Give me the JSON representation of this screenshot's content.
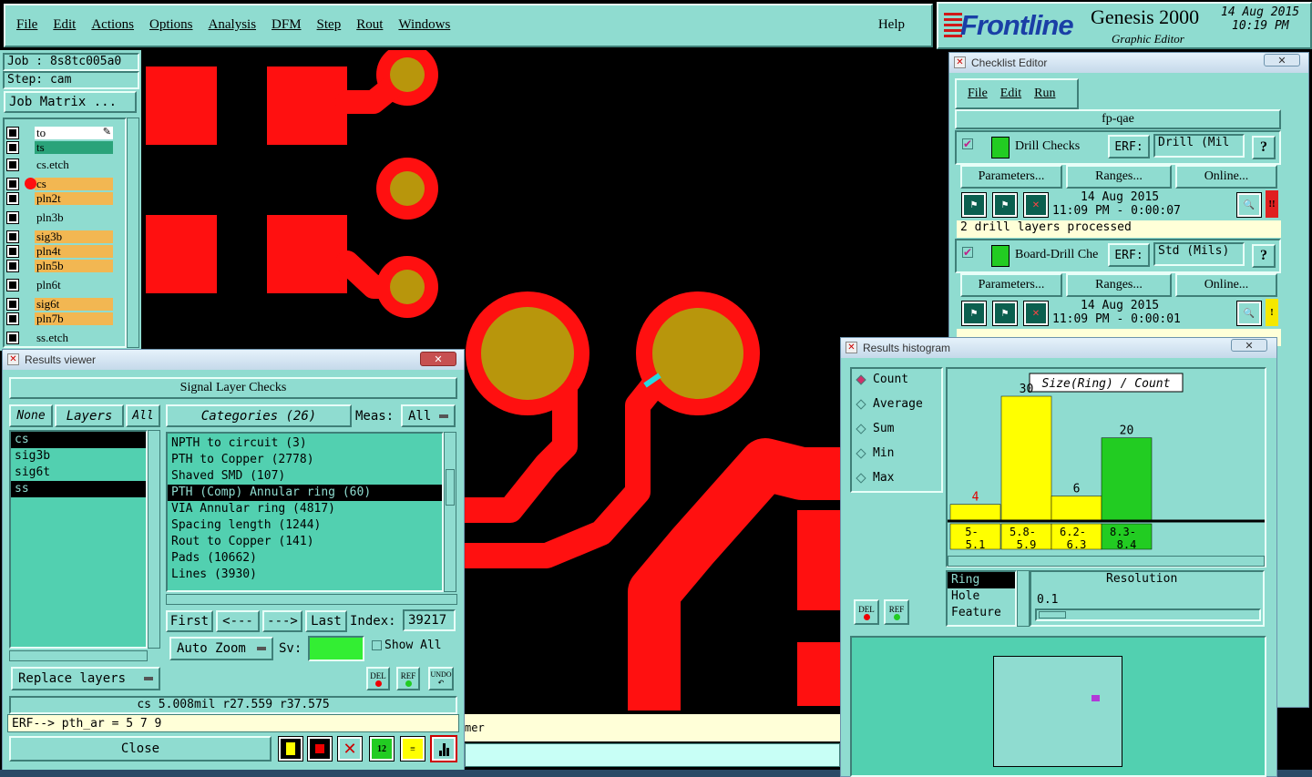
{
  "menubar": {
    "items": [
      "File",
      "Edit",
      "Actions",
      "Options",
      "Analysis",
      "DFM",
      "Step",
      "Rout",
      "Windows"
    ],
    "help": "Help"
  },
  "brand": {
    "logo": "Frontline",
    "product": "Genesis 2000",
    "subtitle": "Graphic Editor",
    "date": "14 Aug 2015",
    "time": "10:19 PM"
  },
  "job": {
    "job_label": "Job : 8s8tc005a0",
    "step_label": "Step: cam",
    "matrix_button": "Job Matrix ..."
  },
  "layers": [
    {
      "name": "to",
      "color": "#ffffff"
    },
    {
      "name": "ts",
      "color": "#2aa37a"
    },
    {
      "name": "cs.etch",
      "color": "#8fdcd0"
    },
    {
      "name": "cs",
      "color": "#f2b752"
    },
    {
      "name": "pln2t",
      "color": "#f2b752"
    },
    {
      "name": "pln3b",
      "color": "#8fdcd0"
    },
    {
      "name": "sig3b",
      "color": "#f2b752"
    },
    {
      "name": "pln4t",
      "color": "#f2b752"
    },
    {
      "name": "pln5b",
      "color": "#f2b752"
    },
    {
      "name": "pln6t",
      "color": "#8fdcd0"
    },
    {
      "name": "sig6t",
      "color": "#f2b752"
    },
    {
      "name": "pln7b",
      "color": "#f2b752"
    },
    {
      "name": "ss.etch",
      "color": "#8fdcd0"
    }
  ],
  "results_viewer": {
    "title": "Results viewer",
    "heading": "Signal Layer Checks",
    "none_btn": "None",
    "layers_btn": "Layers",
    "all_btn": "All",
    "layer_list": [
      {
        "name": "cs",
        "selected": true
      },
      {
        "name": "sig3b",
        "selected": false
      },
      {
        "name": "sig6t",
        "selected": false
      },
      {
        "name": "ss",
        "selected": true
      }
    ],
    "categories_btn": "Categories (26)",
    "meas_label": "Meas:",
    "meas_value": "All",
    "categories": [
      {
        "text": "NPTH to circuit (3)",
        "selected": false
      },
      {
        "text": "PTH to Copper (2778)",
        "selected": false
      },
      {
        "text": "Shaved SMD (107)",
        "selected": false
      },
      {
        "text": "PTH (Comp) Annular ring (60)",
        "selected": true
      },
      {
        "text": "VIA Annular ring (4817)",
        "selected": false
      },
      {
        "text": "Spacing length (1244)",
        "selected": false
      },
      {
        "text": "Rout to Copper (141)",
        "selected": false
      },
      {
        "text": "Pads (10662)",
        "selected": false
      },
      {
        "text": "Lines (3930)",
        "selected": false
      }
    ],
    "first": "First",
    "prev": "<---",
    "next": "--->",
    "last": "Last",
    "index_label": "Index:",
    "index_value": "39217",
    "autozoom": "Auto Zoom",
    "sv_label": "Sv:",
    "show_all": "Show All",
    "replace_layers": "Replace layers",
    "del": "DEL",
    "ref": "REF",
    "undo": "UNDO",
    "status": "cs 5.008mil  r27.559  r37.575",
    "erf": "ERF--> pth_ar = 5 7 9",
    "close": "Close"
  },
  "status_fragment": "mer",
  "checklist": {
    "title": "Checklist Editor",
    "menu": [
      "File",
      "Edit",
      "Run"
    ],
    "name": "fp-qae",
    "checks": [
      {
        "name": "Drill Checks",
        "erf_label": "ERF:",
        "erf_value": "Drill (Mil",
        "help": "?",
        "params": "Parameters...",
        "ranges": "Ranges...",
        "online": "Online...",
        "date": "14 Aug 2015",
        "time": "11:09 PM - 0:00:07",
        "status": "!!",
        "status_color": "#e02020",
        "message": "2 drill layers processed"
      },
      {
        "name": "Board-Drill Che",
        "erf_label": "ERF:",
        "erf_value": "Std (Mils)",
        "help": "?",
        "params": "Parameters...",
        "ranges": "Ranges...",
        "online": "Online...",
        "date": "14 Aug 2015",
        "time": "11:09 PM - 0:00:01",
        "status": "!",
        "status_color": "#f5e800",
        "message": ""
      }
    ]
  },
  "histogram": {
    "title": "Results histogram",
    "modes": [
      "Count",
      "Average",
      "Sum",
      "Min",
      "Max"
    ],
    "selected_mode": "Count",
    "chart_title": "Size(Ring) / Count",
    "ranges": [
      "Ring",
      "Hole",
      "Feature"
    ],
    "selected_range": "Ring",
    "resolution_label": "Resolution",
    "resolution_value": "0.1",
    "del": "DEL",
    "ref": "REF"
  },
  "chart_data": {
    "type": "bar",
    "title": "Size(Ring) / Count",
    "categories": [
      "5-5.1",
      "5.8-5.9",
      "6.2-6.3",
      "8.3-8.4"
    ],
    "values": [
      4,
      30,
      6,
      20
    ],
    "colors": [
      "#ffff00",
      "#ffff00",
      "#ffff00",
      "#22cc22"
    ],
    "label_colors": [
      "#e00000",
      "#000000",
      "#000000",
      "#000000"
    ],
    "ylim": [
      0,
      30
    ]
  }
}
